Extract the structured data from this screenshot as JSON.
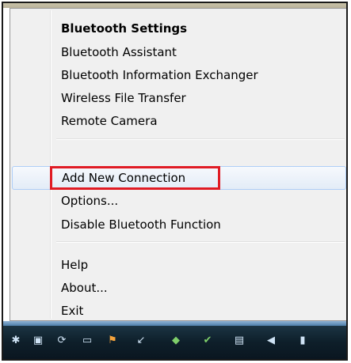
{
  "menu": {
    "items": [
      {
        "label": "Bluetooth Settings",
        "bold": true
      },
      {
        "label": "Bluetooth Assistant"
      },
      {
        "label": "Bluetooth Information Exchanger"
      },
      {
        "label": "Wireless File Transfer"
      },
      {
        "label": "Remote Camera"
      },
      {
        "label": "Add New Connection",
        "hovered": true,
        "highlighted": true
      },
      {
        "label": "Options..."
      },
      {
        "label": "Disable Bluetooth Function"
      },
      {
        "label": "Help"
      },
      {
        "label": "About..."
      },
      {
        "label": "Exit"
      }
    ]
  },
  "taskbar": {
    "tray_icons": [
      "bluetooth-icon",
      "network-icon",
      "sync-icon",
      "battery-icon",
      "flag-icon",
      "arrow-icon",
      "shield-icon",
      "check-icon",
      "monitor-icon",
      "volume-icon",
      "signal-icon"
    ]
  },
  "colors": {
    "highlight_border": "#e01b24",
    "hover_border": "#aecef7",
    "menu_background": "#f0f0f0"
  }
}
